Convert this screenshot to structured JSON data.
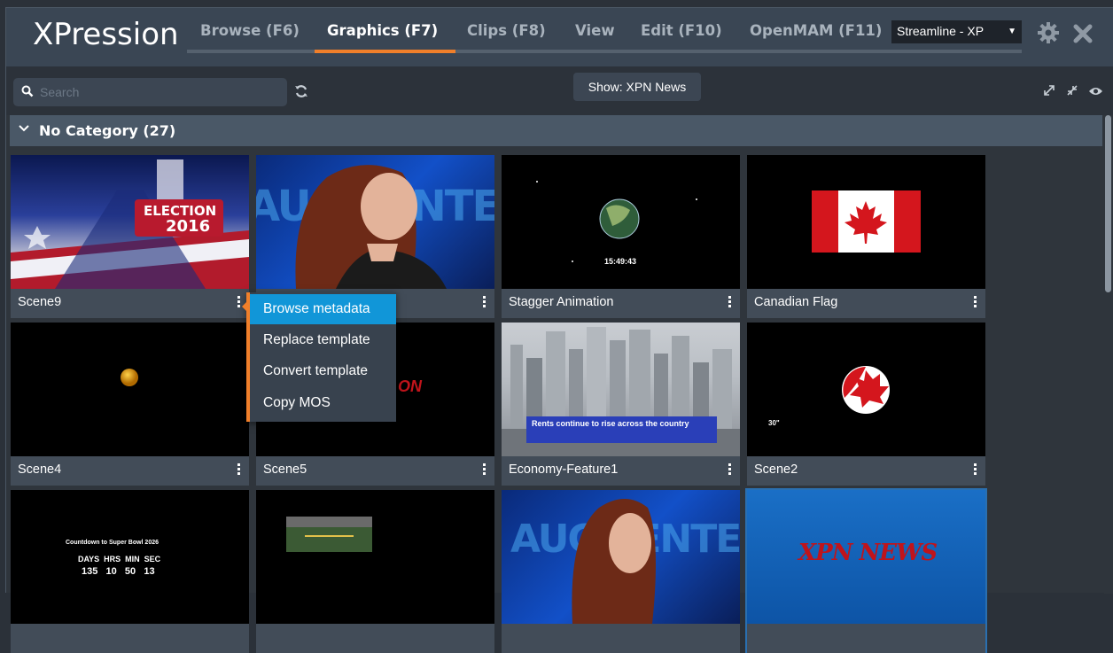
{
  "app": {
    "title": "XPression"
  },
  "tabs": [
    {
      "label": "Browse (F6)",
      "active": false
    },
    {
      "label": "Graphics (F7)",
      "active": true
    },
    {
      "label": "Clips (F8)",
      "active": false
    },
    {
      "label": "View",
      "active": false
    },
    {
      "label": "Edit (F10)",
      "active": false
    },
    {
      "label": "OpenMAM (F11)",
      "active": false
    }
  ],
  "workspace": {
    "selected": "Streamline - XP"
  },
  "search": {
    "placeholder": "Search"
  },
  "show_button": {
    "label": "Show: XPN News"
  },
  "category": {
    "title": "No Category (27)",
    "expanded": true
  },
  "cards": [
    {
      "label": "Scene9",
      "thumb": "election-2016"
    },
    {
      "label": "",
      "thumb": "augmented-woman"
    },
    {
      "label": "Stagger Animation",
      "thumb": "globe"
    },
    {
      "label": "Canadian Flag",
      "thumb": "canada-flag"
    },
    {
      "label": "Scene4",
      "thumb": "orange-ball"
    },
    {
      "label": "Scene5",
      "thumb": "red-text"
    },
    {
      "label": "Economy-Feature1",
      "thumb": "city-skyline"
    },
    {
      "label": "Scene2",
      "thumb": "maple-circle"
    },
    {
      "label": "",
      "thumb": "countdown"
    },
    {
      "label": "",
      "thumb": "stadium"
    },
    {
      "label": "",
      "thumb": "augmented-woman-2"
    },
    {
      "label": "",
      "thumb": "xpn-news"
    }
  ],
  "thumb_text": {
    "election_line1": "ELECTION",
    "election_line2": "2016",
    "augmented": "AUGMENTED",
    "globe_time": "15:49:43",
    "scene5_text": "ON",
    "economy_caption": "Rents continue to rise across the country",
    "scene2_text": "30\"",
    "countdown_title": "Countdown to Super Bowl 2026",
    "countdown_labels": "DAYS  HRS  MIN  SEC",
    "countdown_values": "135   10   50   13",
    "xpn_news": "XPN NEWS"
  },
  "context_menu": {
    "items": [
      {
        "label": "Browse metadata",
        "highlighted": true
      },
      {
        "label": "Replace template",
        "highlighted": false
      },
      {
        "label": "Convert template",
        "highlighted": false
      },
      {
        "label": "Copy MOS",
        "highlighted": false
      }
    ]
  },
  "colors": {
    "accent": "#f07f2a",
    "highlight": "#1196d8",
    "topbar": "#3a4654",
    "category": "#4a5867"
  },
  "icons": [
    "search-icon",
    "refresh-icon",
    "gear-icon",
    "close-icon",
    "expand-icon",
    "collapse-icon",
    "eye-icon",
    "chevron-down-icon",
    "kebab-icon"
  ]
}
